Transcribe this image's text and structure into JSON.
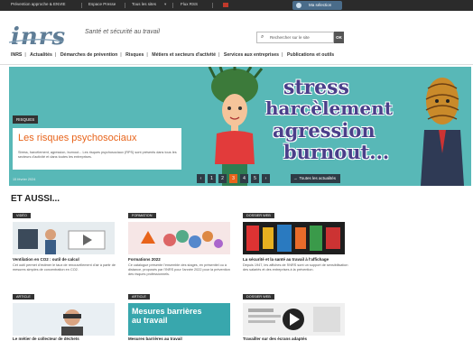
{
  "topbar": {
    "links": [
      "Prévention approche & ENVIE",
      "Espace Presse",
      "Tous les sites",
      "Flux RSS"
    ],
    "select_label": "Ma sélection"
  },
  "header": {
    "logo": "inrs",
    "tagline": "Santé et sécurité au travail",
    "search_placeholder": "Rechercher sur le site",
    "search_button": "OK"
  },
  "nav": {
    "items": [
      "INRS",
      "Actualités",
      "Démarches de prévention",
      "Risques",
      "Métiers et secteurs d'activité",
      "Services aux entreprises",
      "Publications et outils"
    ]
  },
  "hero": {
    "badge": "RISQUES",
    "title": "Les risques psychosociaux",
    "description": "Stress, harcèlement, agression, burnout... Les risques psychosociaux (RPS) sont présents dans tous les secteurs d'activité et dans toutes les entreprises.",
    "date": "15 février 2024",
    "slogan_lines": [
      "stress",
      "harcèlement",
      "agression",
      "burnout..."
    ],
    "pager": [
      "‹",
      "1",
      "2",
      "3",
      "4",
      "5",
      "›"
    ],
    "active_page": "3",
    "all_news": "Toutes les actualités"
  },
  "section_title": "ET AUSSI...",
  "cards": [
    {
      "badge": "VIDÉO",
      "title": "Ventilation en CO2 : outil de calcul",
      "desc": "Cet outil permet d'estimer le taux de renouvellement d'air à partir de mesures simples de concentration en CO2."
    },
    {
      "badge": "FORMATION",
      "title": "Formations 2022",
      "desc": "Ce catalogue présente l'ensemble des stages, en présentiel ou à distance, proposés par l'INRS pour l'année 2022 pour la prévention des risques professionnels."
    },
    {
      "badge": "DOSSIER WEB",
      "title": "La sécurité et la santé au travail à l'affichage",
      "desc": "Depuis 1947, les affiches de l'INRS sont un support de sensibilisation des salariés et des entreprises à la prévention."
    },
    {
      "badge": "ARTICLE",
      "title": "Le métier de collecteur de déchets",
      "desc": ""
    },
    {
      "badge": "ARTICLE",
      "title": "Mesures barrières au travail",
      "desc": "",
      "image_text": "Mesures barrières au travail"
    },
    {
      "badge": "DOSSIER WEB",
      "title": "Travailler sur des écrans adaptés",
      "desc": ""
    }
  ],
  "colors": {
    "accent": "#e8641b",
    "hero_bg": "#58b8b7",
    "logo": "#5f7d96",
    "slogan": "#4a3f8a"
  }
}
